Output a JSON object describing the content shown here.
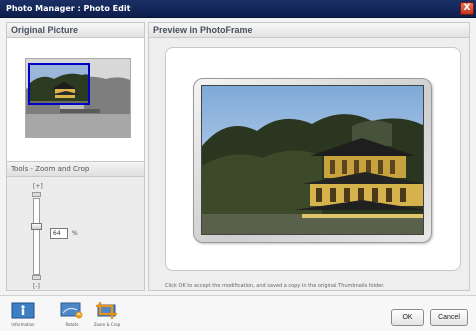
{
  "window": {
    "title": "Photo Manager : Photo Edit",
    "close_glyph": "X"
  },
  "left_panel": {
    "header": "Original Picture"
  },
  "tools": {
    "header": "Tools - Zoom and Crop",
    "zoom_plus": "[+]",
    "zoom_minus": "[-]",
    "zoom_value": "64",
    "zoom_unit": "%",
    "zoom_fraction": 0.64
  },
  "right_panel": {
    "header": "Preview in PhotoFrame",
    "footer_note": "Click OK to accept the modification, and saved a copy in the original Thumbnails folder."
  },
  "toolbar": {
    "items": [
      {
        "label": "Information",
        "icon": "information-icon"
      },
      {
        "label": "Rotate",
        "icon": "rotate-icon"
      },
      {
        "label": "Zoom & Crop",
        "icon": "crop-icon"
      }
    ]
  },
  "buttons": {
    "ok": "OK",
    "cancel": "Cancel"
  },
  "colors": {
    "titlebar": "#0d1f4c",
    "selection": "#0000c8",
    "close": "#c2361f"
  }
}
